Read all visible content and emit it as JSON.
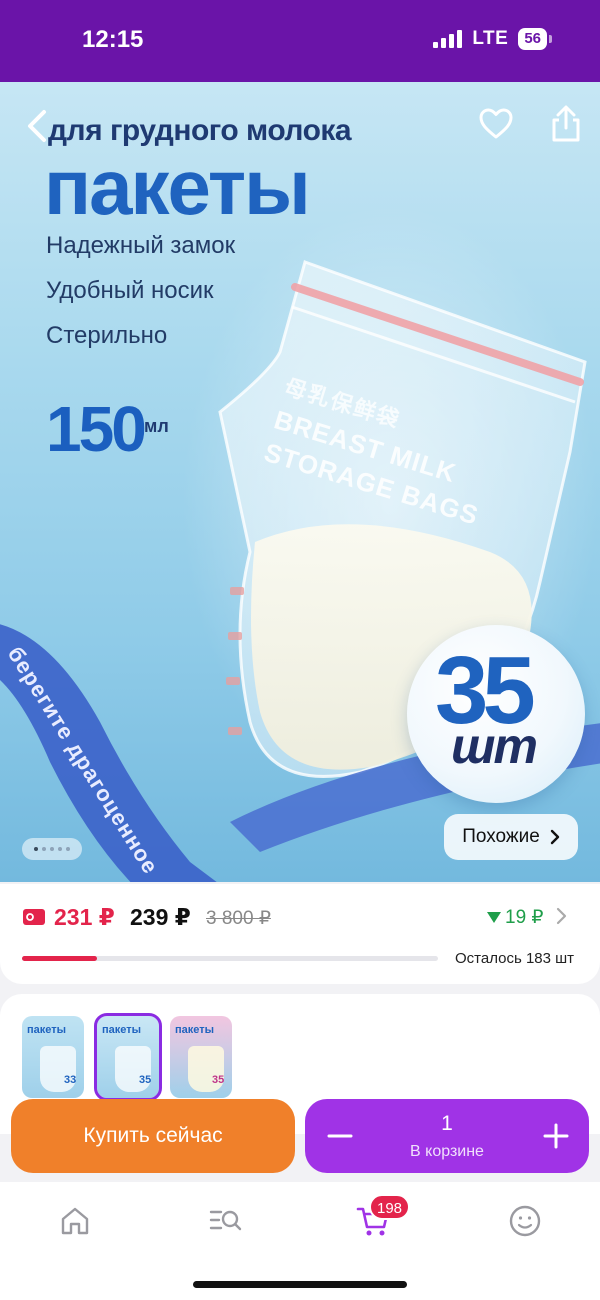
{
  "status_bar": {
    "time": "12:15",
    "network": "LTE",
    "battery": "56"
  },
  "hero": {
    "subtitle": "для грудного молока",
    "title": "пакеты",
    "features": [
      "Надежный замок",
      "Удобный носик",
      "Стерильно"
    ],
    "volume": "150",
    "volume_unit": "мл",
    "bag_text_cn": "母乳保鲜袋",
    "bag_text_en_1": "BREAST MILK",
    "bag_text_en_2": "STORAGE BAGS",
    "ribbon_text": "берегите драгоценное",
    "count": "35",
    "count_unit": "шт",
    "similar_label": "Похожие",
    "gallery_count": 5,
    "gallery_active": 0
  },
  "price": {
    "current": "231 ₽",
    "second": "239 ₽",
    "old": "3 800 ₽",
    "discount": "19 ₽",
    "stock_label": "Осталось 183 шт",
    "stock_progress": 0.18
  },
  "variants": [
    {
      "title": "пакеты",
      "count": "33",
      "color": "#bfe3f3",
      "selected": false
    },
    {
      "title": "пакеты",
      "count": "35",
      "color": "#c9e7f5",
      "selected": true
    },
    {
      "title": "пакеты",
      "count": "35",
      "color": "#f2c6e0",
      "selected": false
    }
  ],
  "actions": {
    "buy_now": "Купить сейчас",
    "quantity": "1",
    "in_cart": "В корзине"
  },
  "tab_bar": {
    "items": [
      "home-icon",
      "catalog-search-icon",
      "cart-icon",
      "profile-icon"
    ],
    "cart_badge": "198",
    "accent": "#a033e6"
  },
  "colors": {
    "status_bar": "#6a14a8",
    "price": "#e3244b",
    "buy": "#f0802a",
    "cart": "#a033e6",
    "discount": "#1f9e4a"
  }
}
